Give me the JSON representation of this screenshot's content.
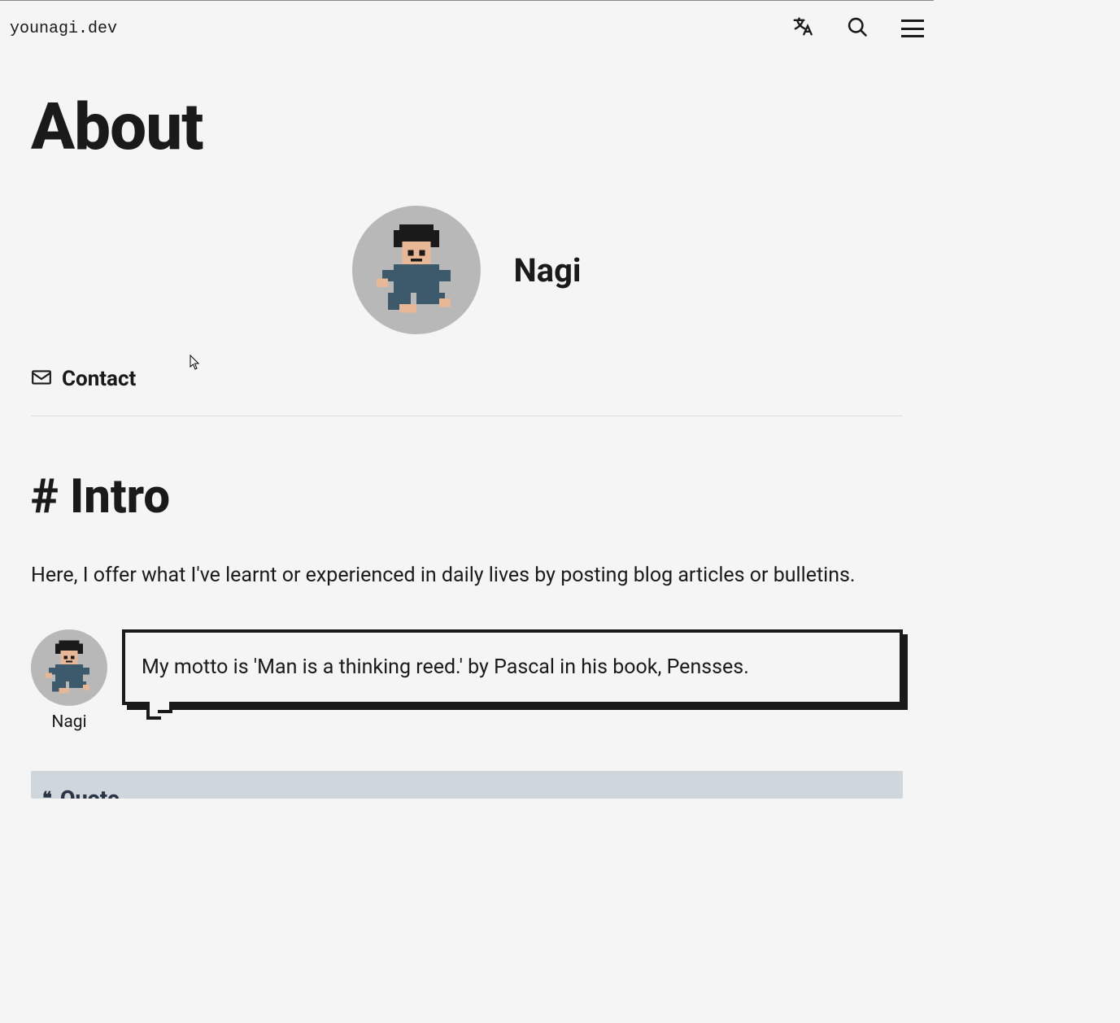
{
  "header": {
    "logo": "younagi.dev"
  },
  "page": {
    "title": "About",
    "author": "Nagi",
    "contact_label": "Contact"
  },
  "intro": {
    "heading": "Intro",
    "hash": "#",
    "text": "Here, I offer what I've learnt or experienced in daily lives by posting blog articles or bulletins."
  },
  "speech": {
    "name": "Nagi",
    "text": "My motto is 'Man is a thinking reed.' by Pascal in his book, Pensses."
  },
  "quote_card": {
    "heading": "Quote"
  }
}
